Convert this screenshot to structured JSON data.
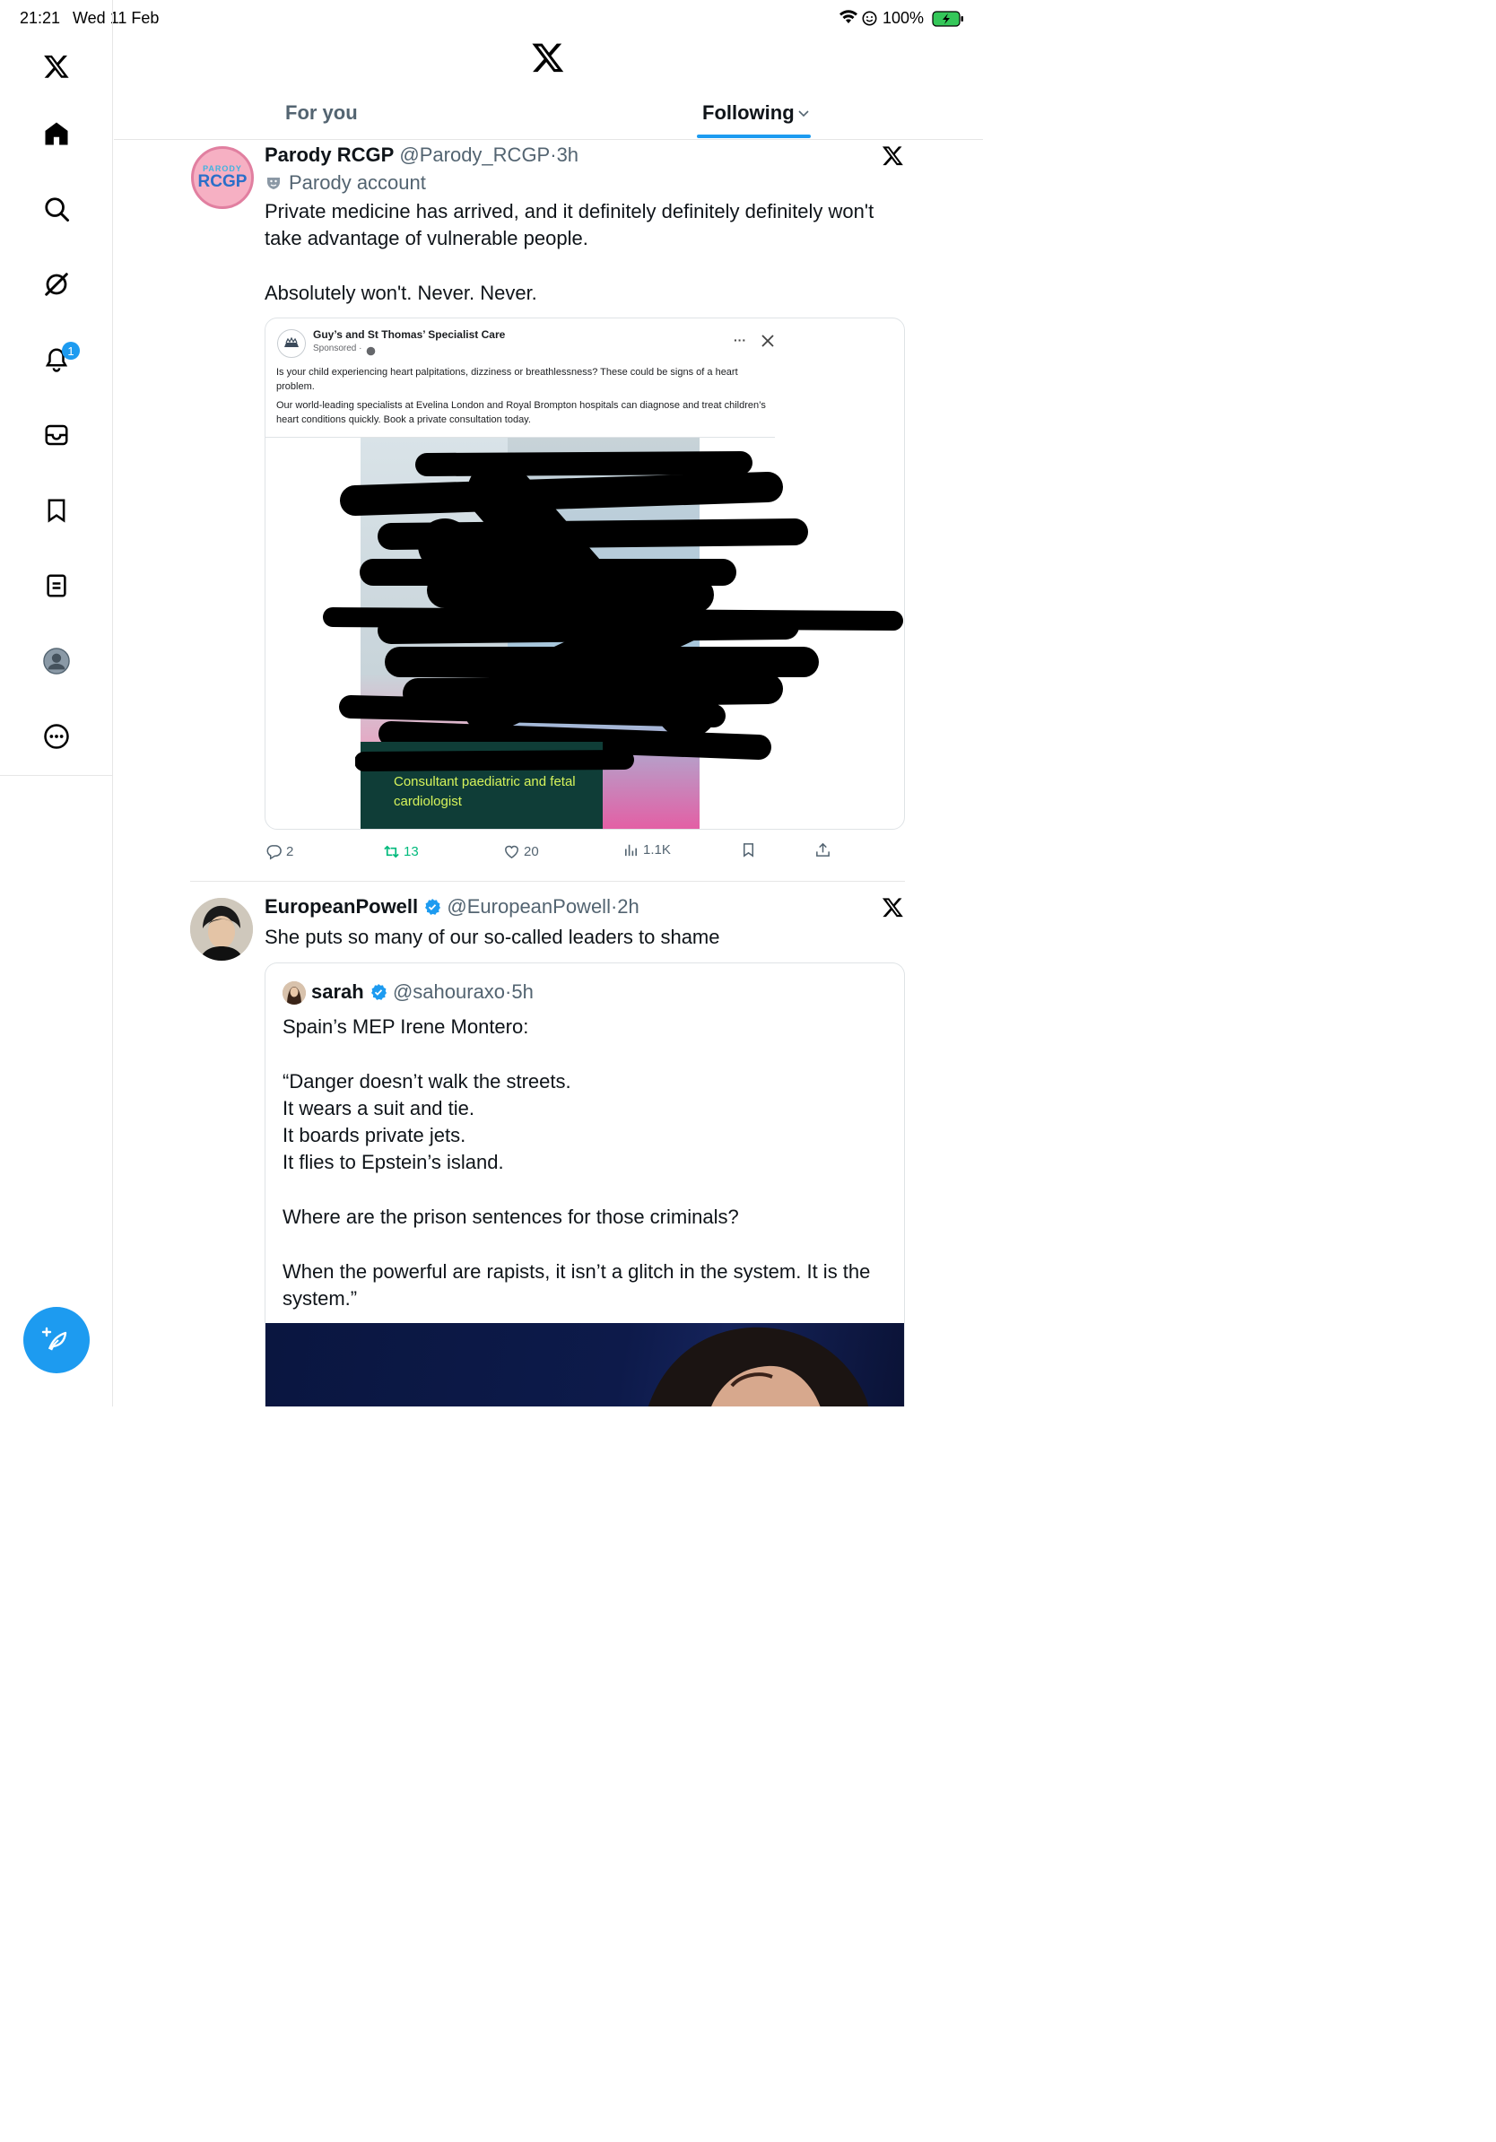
{
  "status_bar": {
    "time": "21:21",
    "date": "Wed 11 Feb",
    "battery": "100%"
  },
  "sidebar": {
    "notifications_badge": "1",
    "items": [
      "home-icon",
      "search-icon",
      "grok-icon",
      "notifications-icon",
      "messages-icon",
      "bookmarks-icon",
      "lists-icon",
      "profile-icon",
      "more-icon"
    ]
  },
  "tabs": {
    "for_you": "For you",
    "following": "Following"
  },
  "tweet1": {
    "name": "Parody RCGP",
    "handle": "@Parody_RCGP",
    "time": "3h",
    "label": "Parody account",
    "avatar_top": "PARODY",
    "avatar_main": "RCGP",
    "text_line1": "Private medicine has arrived, and it definitely definitely definitely won't take advantage of vulnerable people.",
    "text_line2": "Absolutely won't. Never. Never.",
    "ad": {
      "sponsor_name": "Guy’s and St Thomas’ Specialist Care",
      "sponsored": "Sponsored · ",
      "para1": "Is your child experiencing heart palpitations, dizziness or breathlessness? These could be signs of a heart problem.",
      "para2": "Our world-leading specialists at Evelina London and Royal Brompton hospitals can diagnose and treat children’s heart conditions quickly. Book a private consultation today.",
      "caption": "Consultant paediatric and fetal cardiologist"
    },
    "actions": {
      "replies": "2",
      "reposts": "13",
      "likes": "20",
      "views": "1.1K"
    }
  },
  "tweet2": {
    "name": "EuropeanPowell",
    "handle": "@EuropeanPowell",
    "time": "2h",
    "text": "She puts so many of our so-called leaders to shame",
    "quote": {
      "name": "sarah",
      "handle": "@sahouraxo",
      "time": "5h",
      "line1": "Spain’s MEP Irene Montero:",
      "line2": "“Danger doesn’t walk the streets.",
      "line3": "It wears a suit and tie.",
      "line4": "It boards private jets.",
      "line5": "It flies to Epstein’s island.",
      "line6": "Where are the prison sentences for those criminals?",
      "line7": "When the powerful are rapists, it isn’t a glitch in the system. It is the system.”"
    }
  },
  "colors": {
    "accent": "#1d9bf0",
    "repost": "#00ba7c",
    "muted": "#536471"
  }
}
